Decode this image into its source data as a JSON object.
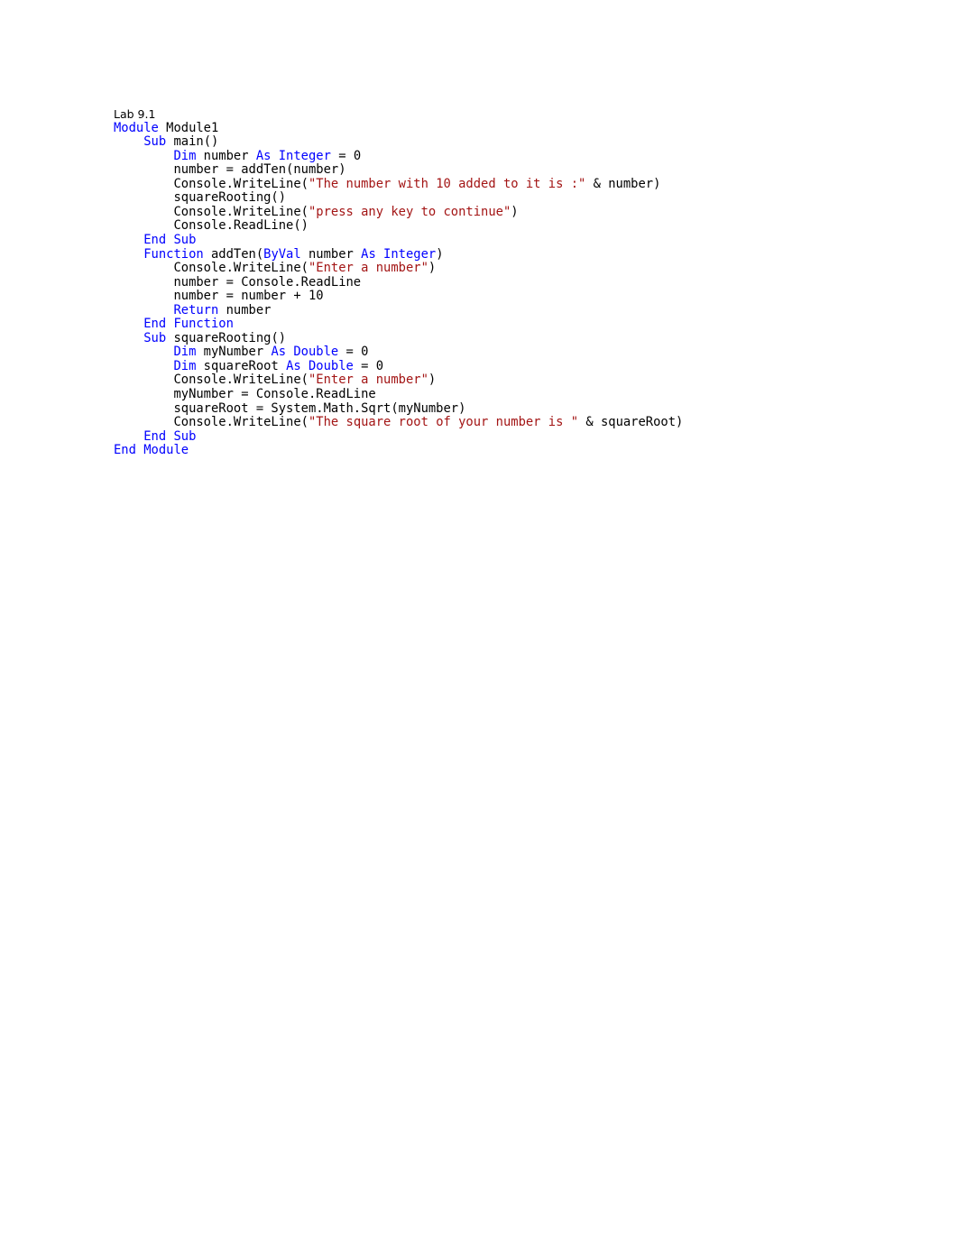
{
  "document": {
    "title_line": "Lab 9.1",
    "language": "Visual Basic .NET",
    "colors": {
      "background": "#ffffff",
      "default_text": "#000000",
      "keyword": "#0000ff",
      "string": "#a31515"
    },
    "code_lines": [
      {
        "indent": 0,
        "tokens": [
          {
            "t": "Module",
            "k": "kw"
          },
          {
            "t": " Module1",
            "k": "plain"
          }
        ]
      },
      {
        "indent": 4,
        "tokens": [
          {
            "t": "Sub",
            "k": "kw"
          },
          {
            "t": " main()",
            "k": "plain"
          }
        ]
      },
      {
        "indent": 8,
        "tokens": [
          {
            "t": "Dim",
            "k": "kw"
          },
          {
            "t": " number ",
            "k": "plain"
          },
          {
            "t": "As Integer",
            "k": "kw"
          },
          {
            "t": " = 0",
            "k": "plain"
          }
        ]
      },
      {
        "indent": 8,
        "tokens": [
          {
            "t": "number = addTen(number)",
            "k": "plain"
          }
        ]
      },
      {
        "indent": 8,
        "tokens": [
          {
            "t": "Console.WriteLine(",
            "k": "plain"
          },
          {
            "t": "\"The number with 10 added to it is :\"",
            "k": "str"
          },
          {
            "t": " & number)",
            "k": "plain"
          }
        ]
      },
      {
        "indent": 8,
        "tokens": [
          {
            "t": "squareRooting()",
            "k": "plain"
          }
        ]
      },
      {
        "indent": 8,
        "tokens": [
          {
            "t": "Console.WriteLine(",
            "k": "plain"
          },
          {
            "t": "\"press any key to continue\"",
            "k": "str"
          },
          {
            "t": ")",
            "k": "plain"
          }
        ]
      },
      {
        "indent": 8,
        "tokens": [
          {
            "t": "Console.ReadLine()",
            "k": "plain"
          }
        ]
      },
      {
        "indent": 4,
        "tokens": [
          {
            "t": "End Sub",
            "k": "kw"
          }
        ]
      },
      {
        "indent": 4,
        "tokens": [
          {
            "t": "Function",
            "k": "kw"
          },
          {
            "t": " addTen(",
            "k": "plain"
          },
          {
            "t": "ByVal",
            "k": "kw"
          },
          {
            "t": " number ",
            "k": "plain"
          },
          {
            "t": "As Integer",
            "k": "kw"
          },
          {
            "t": ")",
            "k": "plain"
          }
        ]
      },
      {
        "indent": 8,
        "tokens": [
          {
            "t": "Console.WriteLine(",
            "k": "plain"
          },
          {
            "t": "\"Enter a number\"",
            "k": "str"
          },
          {
            "t": ")",
            "k": "plain"
          }
        ]
      },
      {
        "indent": 8,
        "tokens": [
          {
            "t": "number = Console.ReadLine",
            "k": "plain"
          }
        ]
      },
      {
        "indent": 8,
        "tokens": [
          {
            "t": "number = number + 10",
            "k": "plain"
          }
        ]
      },
      {
        "indent": 8,
        "tokens": [
          {
            "t": "Return",
            "k": "kw"
          },
          {
            "t": " number",
            "k": "plain"
          }
        ]
      },
      {
        "indent": 4,
        "tokens": [
          {
            "t": "End Function",
            "k": "kw"
          }
        ]
      },
      {
        "indent": 4,
        "tokens": [
          {
            "t": "Sub",
            "k": "kw"
          },
          {
            "t": " squareRooting()",
            "k": "plain"
          }
        ]
      },
      {
        "indent": 8,
        "tokens": [
          {
            "t": "Dim",
            "k": "kw"
          },
          {
            "t": " myNumber ",
            "k": "plain"
          },
          {
            "t": "As Double",
            "k": "kw"
          },
          {
            "t": " = 0",
            "k": "plain"
          }
        ]
      },
      {
        "indent": 8,
        "tokens": [
          {
            "t": "Dim",
            "k": "kw"
          },
          {
            "t": " squareRoot ",
            "k": "plain"
          },
          {
            "t": "As Double",
            "k": "kw"
          },
          {
            "t": " = 0",
            "k": "plain"
          }
        ]
      },
      {
        "indent": 8,
        "tokens": [
          {
            "t": "Console.WriteLine(",
            "k": "plain"
          },
          {
            "t": "\"Enter a number\"",
            "k": "str"
          },
          {
            "t": ")",
            "k": "plain"
          }
        ]
      },
      {
        "indent": 8,
        "tokens": [
          {
            "t": "myNumber = Console.ReadLine",
            "k": "plain"
          }
        ]
      },
      {
        "indent": 8,
        "tokens": [
          {
            "t": "squareRoot = System.Math.Sqrt(myNumber)",
            "k": "plain"
          }
        ]
      },
      {
        "indent": 8,
        "tokens": [
          {
            "t": "Console.WriteLine(",
            "k": "plain"
          },
          {
            "t": "\"The square root of your number is \"",
            "k": "str"
          },
          {
            "t": " & squareRoot)",
            "k": "plain"
          }
        ]
      },
      {
        "indent": 4,
        "tokens": [
          {
            "t": "End Sub",
            "k": "kw"
          }
        ]
      },
      {
        "indent": 0,
        "tokens": [
          {
            "t": "End Module",
            "k": "kw"
          }
        ]
      }
    ]
  }
}
